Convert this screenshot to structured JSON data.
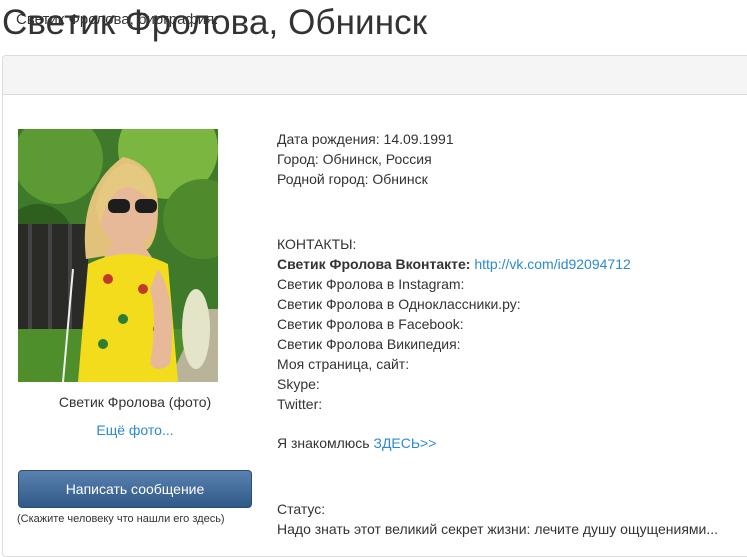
{
  "page": {
    "title": "Светик Фролова, Обнинск"
  },
  "panel": {
    "heading": "Светик Фролова, биография:"
  },
  "profile": {
    "photo_caption": "Светик Фролова (фото)",
    "more_photos_link": "Ещё фото...",
    "message_button": "Написать сообщение",
    "message_hint": "(Скажите человеку что нашли его здесь)"
  },
  "details": {
    "birth_date": "Дата рождения: 14.09.1991",
    "city": "Город: Обнинск, Россия",
    "home_city": "Родной город: Обнинск"
  },
  "contacts": {
    "heading": "КОНТАКТЫ:",
    "vk_label": "Светик Фролова Вконтакте:",
    "vk_link": "http://vk.com/id92094712",
    "instagram": "Светик Фролова в Instagram:",
    "odnoklassniki": "Светик Фролова в Одноклассники.ру:",
    "facebook": "Светик Фролова в Facebook:",
    "wikipedia": "Светик Фролова Википедия:",
    "website": "Моя страница, сайт:",
    "skype": "Skype:",
    "twitter": "Twitter:"
  },
  "dating": {
    "text": "Я знакомлюсь ",
    "link": "ЗДЕСЬ>>"
  },
  "status": {
    "label": "Статус:",
    "text": "Надо знать этот великий секрет жизни: лечите душу ощущениями..."
  },
  "colors": {
    "link": "#2a8ad2",
    "button": "#3b6593",
    "panel_header": "#f5f5f5",
    "text": "#333333"
  }
}
